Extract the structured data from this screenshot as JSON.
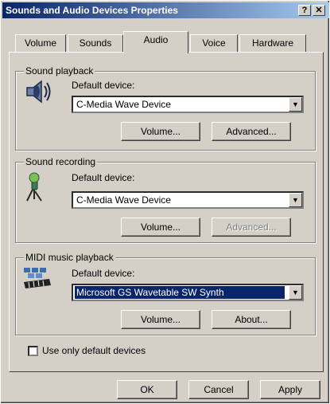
{
  "window": {
    "title": "Sounds and Audio Devices Properties",
    "help_label": "?",
    "close_label": "✕"
  },
  "tabs": [
    {
      "label": "Volume"
    },
    {
      "label": "Sounds"
    },
    {
      "label": "Audio"
    },
    {
      "label": "Voice"
    },
    {
      "label": "Hardware"
    }
  ],
  "sound_playback": {
    "title": "Sound playback",
    "default_device_label": "Default device:",
    "device": "C-Media Wave Device",
    "volume_button": "Volume...",
    "advanced_button": "Advanced..."
  },
  "sound_recording": {
    "title": "Sound recording",
    "default_device_label": "Default device:",
    "device": "C-Media Wave Device",
    "volume_button": "Volume...",
    "advanced_button": "Advanced..."
  },
  "midi_playback": {
    "title": "MIDI music playback",
    "default_device_label": "Default device:",
    "device": "Microsoft GS Wavetable SW Synth",
    "volume_button": "Volume...",
    "about_button": "About..."
  },
  "use_only_default": {
    "label": "Use only default devices"
  },
  "footer": {
    "ok": "OK",
    "cancel": "Cancel",
    "apply": "Apply"
  }
}
